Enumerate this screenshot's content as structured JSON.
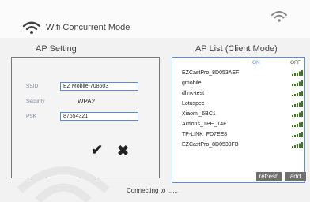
{
  "header": {
    "title": "Wifi Concurrent Mode",
    "title_icon": "wifi-icon",
    "top_right_icon": "wifi-icon"
  },
  "ap_setting": {
    "title": "AP Setting",
    "ssid_label": "SSID",
    "ssid_value": "EZ Mobile-708603",
    "security_label": "Security",
    "security_value": "WPA2",
    "psk_label": "PSK",
    "psk_value": "87654321",
    "confirm_icon": "check-icon",
    "cancel_icon": "close-icon",
    "confirm_symbol": "✔",
    "cancel_symbol": "✖"
  },
  "ap_list": {
    "title": "AP List (Client Mode)",
    "col_on": "ON",
    "col_off": "OFF",
    "items": [
      "EZCastPro_8D053AEF",
      "gmobile",
      "dlink-test",
      "Lotuspec",
      "Xiaomi_6BC1",
      "Actions_TPE_14F",
      "TP-LINK_FD7EE8",
      "EZCastPro_8D0539FB"
    ],
    "signal_icon": "signal-strength-icon",
    "refresh_label": "refresh",
    "add_label": "add"
  },
  "status": {
    "text": "Connecting to ......"
  },
  "colors": {
    "accent": "#5b8dd6",
    "button": "#6f6f6f",
    "signal": "#3a7a1e"
  }
}
